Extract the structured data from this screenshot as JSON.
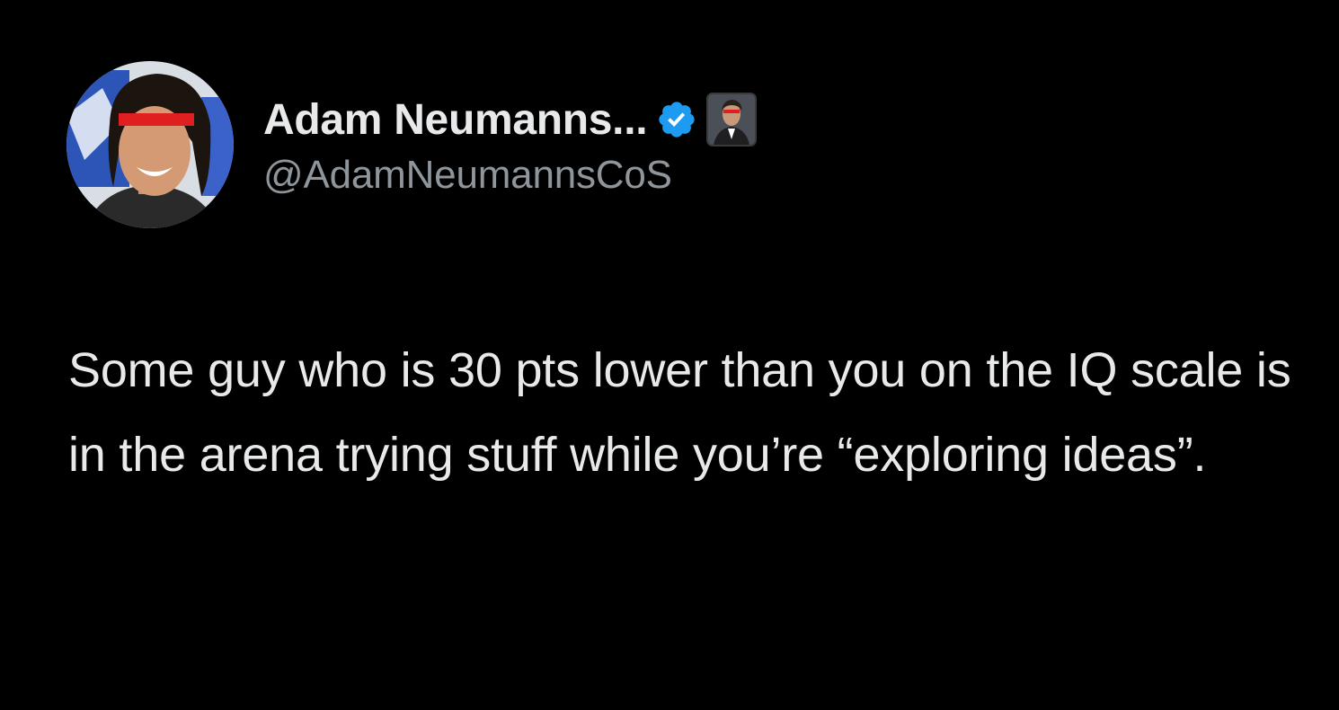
{
  "tweet": {
    "author": {
      "display_name": "Adam Neumanns...",
      "handle": "@AdamNeumannsCoS",
      "verified_icon": "verified-badge-icon",
      "affiliate_icon": "affiliate-avatar",
      "verified_color": "#1d9bf0"
    },
    "text": "Some guy who is 30 pts lower than you on the IQ scale is in the arena trying stuff while you’re “exploring ideas”."
  },
  "theme": {
    "background": "#000000",
    "primary_text": "#e7e9ea",
    "secondary_text": "#8e959b",
    "censor_bar": "#e02020"
  }
}
